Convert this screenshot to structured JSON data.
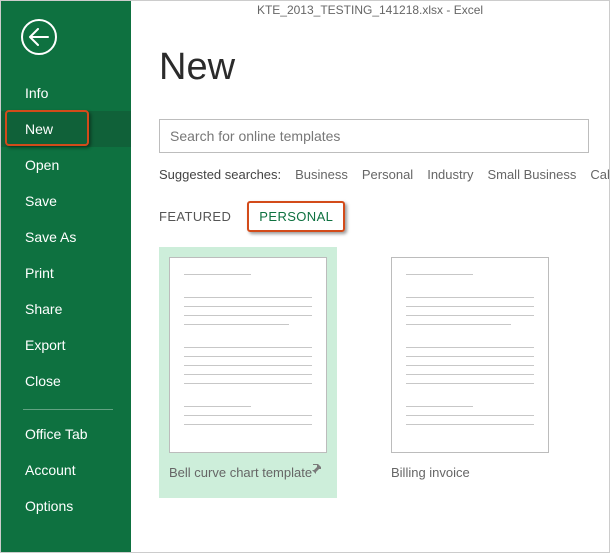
{
  "window_title": "KTE_2013_TESTING_141218.xlsx - Excel",
  "sidebar": {
    "items": [
      "Info",
      "New",
      "Open",
      "Save",
      "Save As",
      "Print",
      "Share",
      "Export",
      "Close"
    ],
    "footer": [
      "Office Tab",
      "Account",
      "Options"
    ],
    "selected": "New"
  },
  "page": {
    "title": "New",
    "search_placeholder": "Search for online templates",
    "suggested_label": "Suggested searches:",
    "suggested_terms": [
      "Business",
      "Personal",
      "Industry",
      "Small Business",
      "Calcu"
    ],
    "tabs": {
      "featured": "FEATURED",
      "personal": "PERSONAL"
    },
    "templates": [
      {
        "name": "Bell curve chart template",
        "selected": true,
        "pinned": true
      },
      {
        "name": "Billing invoice",
        "selected": false,
        "pinned": false
      }
    ]
  }
}
